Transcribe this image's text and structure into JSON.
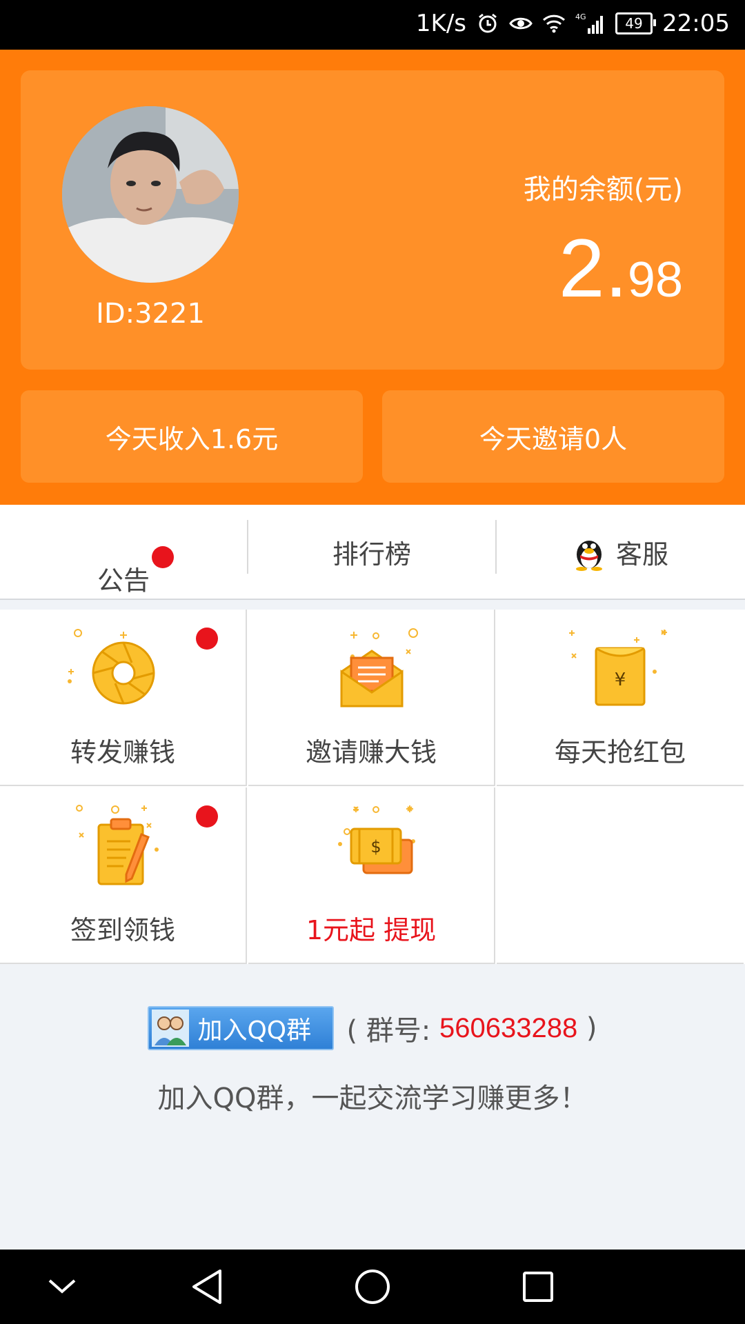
{
  "status_bar": {
    "speed": "1K/s",
    "network": "4G",
    "battery": "49",
    "time": "22:05"
  },
  "profile": {
    "user_id": "ID:3221",
    "balance_label": "我的余额(元)",
    "balance_int": "2",
    "balance_dot": ".",
    "balance_dec": "98"
  },
  "stats": {
    "today_income": "今天收入1.6元",
    "today_invite": "今天邀请0人"
  },
  "tabs": {
    "notice": "公告",
    "ranking": "排行榜",
    "service": "客服"
  },
  "grid": {
    "forward": "转发赚钱",
    "invite": "邀请赚大钱",
    "redpacket": "每天抢红包",
    "checkin": "签到领钱",
    "withdraw": "1元起 提现"
  },
  "footer": {
    "qq_button": "加入QQ群",
    "group_prefix": "( 群号: ",
    "group_number": "560633288",
    "group_suffix": " )",
    "tagline": "加入QQ群，一起交流学习赚更多！"
  },
  "colors": {
    "orange_dark": "#ff7c0a",
    "orange_light": "#ff9028",
    "red_dot": "#e8141c",
    "icon_yellow": "#f9c22e"
  }
}
